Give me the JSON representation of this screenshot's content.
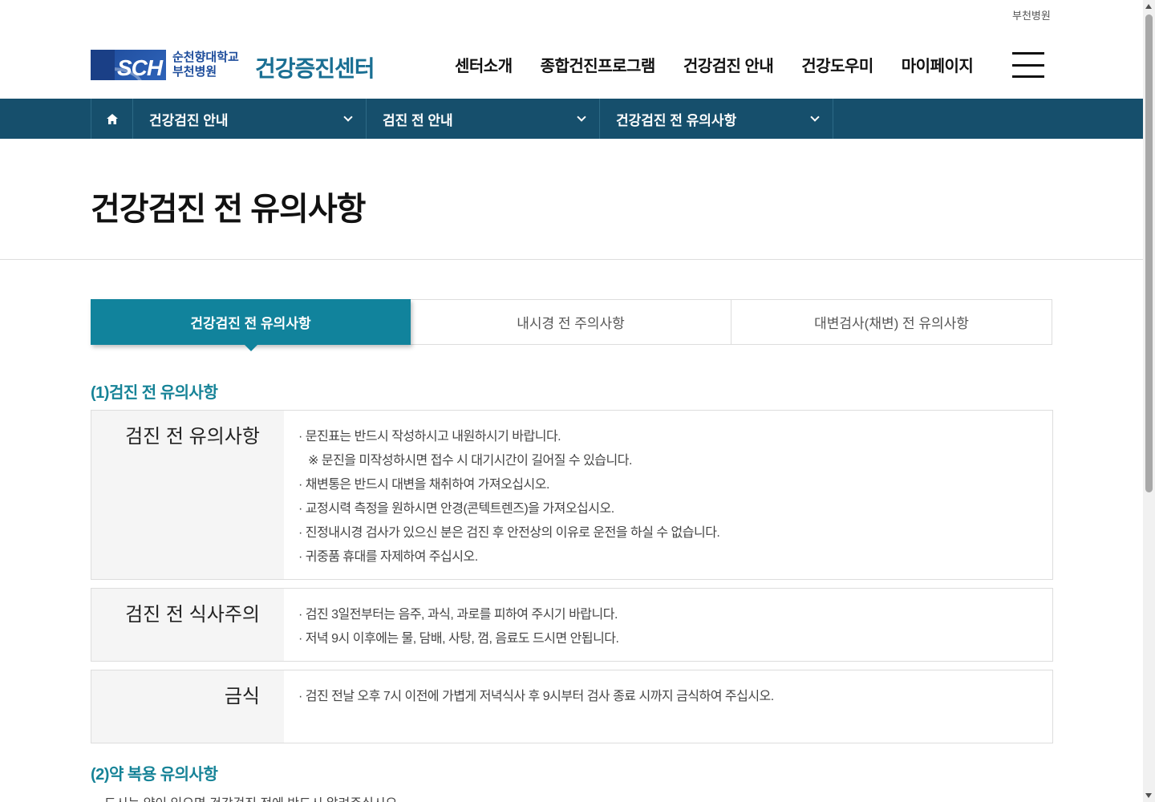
{
  "header": {
    "top_link": "부천병원",
    "logo_mark": "SCH",
    "logo_line1": "순천향대학교",
    "logo_line2": "부천병원",
    "center_title": "건강증진센터",
    "nav": [
      "센터소개",
      "종합건진프로그램",
      "건강검진 안내",
      "건강도우미",
      "마이페이지"
    ]
  },
  "location": {
    "items": [
      "건강검진 안내",
      "검진 전 안내",
      "건강검진 전 유의사항"
    ]
  },
  "page_title": "건강검진 전 유의사항",
  "tabs": [
    "건강검진 전 유의사항",
    "내시경 전 주의사항",
    "대변검사(채변) 전 유의사항"
  ],
  "section1": {
    "title": "(1)검진 전 유의사항",
    "boxes": [
      {
        "label": "검진 전 유의사항",
        "lines": [
          "· 문진표는 반드시 작성하시고 내원하시기 바랍니다.",
          "※ 문진을 미작성하시면 접수 시 대기시간이 길어질 수 있습니다.",
          "· 채변통은 반드시 대변을 채취하여 가져오십시오.",
          "· 교정시력 측정을 원하시면 안경(콘텍트렌즈)을 가져오십시오.",
          "· 진정내시경 검사가 있으신 분은 검진 후 안전상의 이유로 운전을 하실 수 없습니다.",
          "· 귀중품 휴대를 자제하여 주십시오."
        ]
      },
      {
        "label": "검진 전 식사주의",
        "lines": [
          "· 검진 3일전부터는 음주, 과식, 과로를 피하여 주시기 바랍니다.",
          "· 저녁 9시 이후에는 물, 담배, 사탕, 껌, 음료도 드시면 안됩니다."
        ]
      },
      {
        "label": "금식",
        "lines": [
          "· 검진 전날 오후 7시 이전에 가볍게 저녁식사 후 9시부터 검사 종료 시까지 금식하여 주십시오."
        ]
      }
    ]
  },
  "section2": {
    "title": "(2)약 복용 유의사항",
    "first_line": "드시는 약이 있으면 건강검진 전에 반드시 알려주십시오."
  }
}
